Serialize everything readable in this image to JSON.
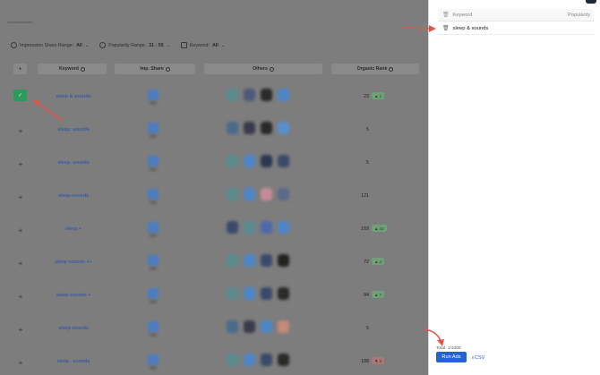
{
  "filters": [
    {
      "label": "Impression Share Range:",
      "value": "All",
      "icon": "share-icon"
    },
    {
      "label": "Popularity Range:",
      "value": "31 - 55",
      "icon": "popularity-icon"
    },
    {
      "label": "Keyword:",
      "value": "All",
      "icon": "keyword-icon"
    }
  ],
  "table": {
    "add_header": "+",
    "headers": {
      "keyword": "Keyword",
      "imp_share": "Imp. Share",
      "others": "Others",
      "organic_rank": "Organic Rank"
    },
    "rows": [
      {
        "keyword": "sleep & sounds",
        "rank": "23",
        "badge": "1",
        "badge_dir": "up",
        "added": true,
        "add_symbol": "✓"
      },
      {
        "keyword": "sleep: sounds",
        "rank": "5",
        "badge": "",
        "badge_dir": "",
        "added": false,
        "add_symbol": "+"
      },
      {
        "keyword": "sleep. sounds",
        "rank": "5",
        "badge": "",
        "badge_dir": "",
        "added": false,
        "add_symbol": "+"
      },
      {
        "keyword": "sleep-sounds",
        "rank": "121",
        "badge": "",
        "badge_dir": "",
        "added": false,
        "add_symbol": "+"
      },
      {
        "keyword": "sleep +",
        "rank": "169",
        "badge": "42",
        "badge_dir": "up",
        "added": false,
        "add_symbol": "+"
      },
      {
        "keyword": "sleep sounds ++",
        "rank": "72",
        "badge": "4",
        "badge_dir": "up",
        "added": false,
        "add_symbol": "+"
      },
      {
        "keyword": "sleep sounds +",
        "rank": "84",
        "badge": "7",
        "badge_dir": "up",
        "added": false,
        "add_symbol": "+"
      },
      {
        "keyword": "sleep sounds",
        "rank": "5",
        "badge": "",
        "badge_dir": "",
        "added": false,
        "add_symbol": "+"
      },
      {
        "keyword": "sleep . sounds",
        "rank": "188",
        "badge": "3",
        "badge_dir": "down",
        "added": false,
        "add_symbol": "+"
      }
    ]
  },
  "drawer": {
    "header": {
      "keyword": "Keyword",
      "popularity": "Popularity"
    },
    "items": [
      {
        "keyword": "sleep & sounds",
        "popularity": ""
      }
    ],
    "total": "Total: 1/1000",
    "run_ads_label": "Run Ads",
    "csv_label": "CSV"
  },
  "colors": {
    "accent": "#2563d4",
    "added_green": "#2e9a5a",
    "overlay": "#7d7d7d",
    "arrow": "#e8534a"
  }
}
